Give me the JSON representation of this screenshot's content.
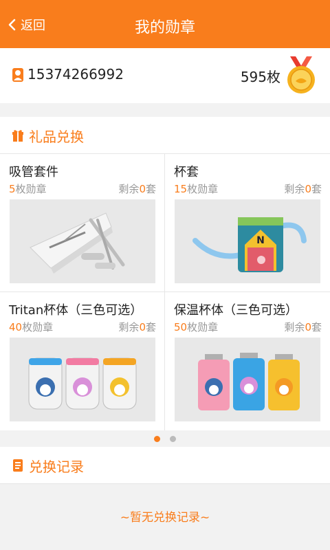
{
  "header": {
    "back_label": "返回",
    "title": "我的勋章"
  },
  "user": {
    "phone": "15374266992",
    "medal_count": "595枚"
  },
  "gifts": {
    "section_title": "礼品兑换",
    "items": [
      {
        "name": "吸管套件",
        "price_num": "5",
        "price_unit": "枚勋章",
        "stock_prefix": "剩余",
        "stock_num": "0",
        "stock_unit": "套"
      },
      {
        "name": "杯套",
        "price_num": "15",
        "price_unit": "枚勋章",
        "stock_prefix": "剩余",
        "stock_num": "0",
        "stock_unit": "套"
      },
      {
        "name": "Tritan杯体（三色可选）",
        "price_num": "40",
        "price_unit": "枚勋章",
        "stock_prefix": "剩余",
        "stock_num": "0",
        "stock_unit": "套"
      },
      {
        "name": "保温杯体（三色可选）",
        "price_num": "50",
        "price_unit": "枚勋章",
        "stock_prefix": "剩余",
        "stock_num": "0",
        "stock_unit": "套"
      }
    ]
  },
  "records": {
    "section_title": "兑换记录",
    "empty_text": "~暂无兑换记录~"
  },
  "pager": {
    "current": 1,
    "total": 2
  },
  "colors": {
    "accent": "#f97d1c",
    "background": "#f2f2f2"
  }
}
